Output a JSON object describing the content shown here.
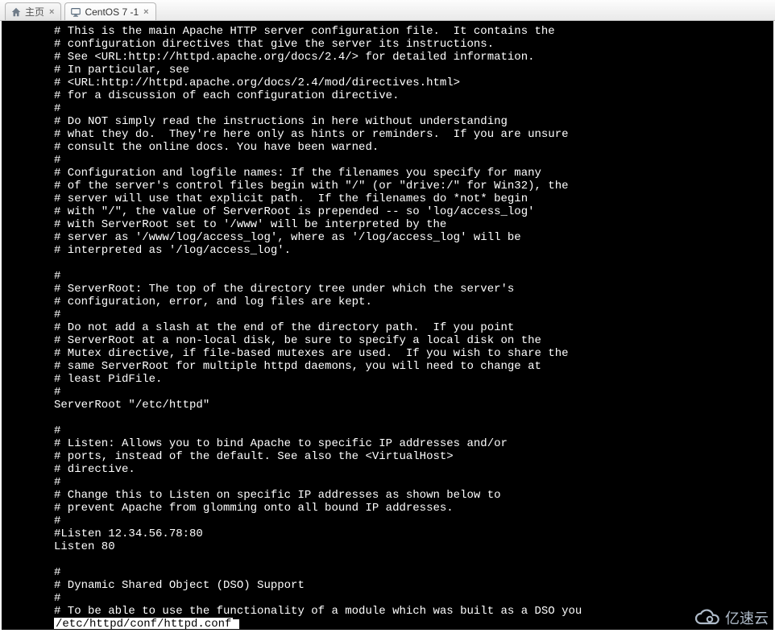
{
  "tabs": [
    {
      "label": "主页",
      "has_close": true
    },
    {
      "label": "CentOS 7 -1",
      "has_close": true
    }
  ],
  "terminal": {
    "lines": [
      "# This is the main Apache HTTP server configuration file.  It contains the",
      "# configuration directives that give the server its instructions.",
      "# See <URL:http://httpd.apache.org/docs/2.4/> for detailed information.",
      "# In particular, see",
      "# <URL:http://httpd.apache.org/docs/2.4/mod/directives.html>",
      "# for a discussion of each configuration directive.",
      "#",
      "# Do NOT simply read the instructions in here without understanding",
      "# what they do.  They're here only as hints or reminders.  If you are unsure",
      "# consult the online docs. You have been warned.",
      "#",
      "# Configuration and logfile names: If the filenames you specify for many",
      "# of the server's control files begin with \"/\" (or \"drive:/\" for Win32), the",
      "# server will use that explicit path.  If the filenames do *not* begin",
      "# with \"/\", the value of ServerRoot is prepended -- so 'log/access_log'",
      "# with ServerRoot set to '/www' will be interpreted by the",
      "# server as '/www/log/access_log', where as '/log/access_log' will be",
      "# interpreted as '/log/access_log'.",
      "",
      "#",
      "# ServerRoot: The top of the directory tree under which the server's",
      "# configuration, error, and log files are kept.",
      "#",
      "# Do not add a slash at the end of the directory path.  If you point",
      "# ServerRoot at a non-local disk, be sure to specify a local disk on the",
      "# Mutex directive, if file-based mutexes are used.  If you wish to share the",
      "# same ServerRoot for multiple httpd daemons, you will need to change at",
      "# least PidFile.",
      "#",
      "ServerRoot \"/etc/httpd\"",
      "",
      "#",
      "# Listen: Allows you to bind Apache to specific IP addresses and/or",
      "# ports, instead of the default. See also the <VirtualHost>",
      "# directive.",
      "#",
      "# Change this to Listen on specific IP addresses as shown below to",
      "# prevent Apache from glomming onto all bound IP addresses.",
      "#",
      "#Listen 12.34.56.78:80",
      "Listen 80",
      "",
      "#",
      "# Dynamic Shared Object (DSO) Support",
      "#",
      "# To be able to use the functionality of a module which was built as a DSO you"
    ],
    "status_path": "/etc/httpd/conf/httpd.conf"
  },
  "watermark": {
    "text": "亿速云"
  }
}
